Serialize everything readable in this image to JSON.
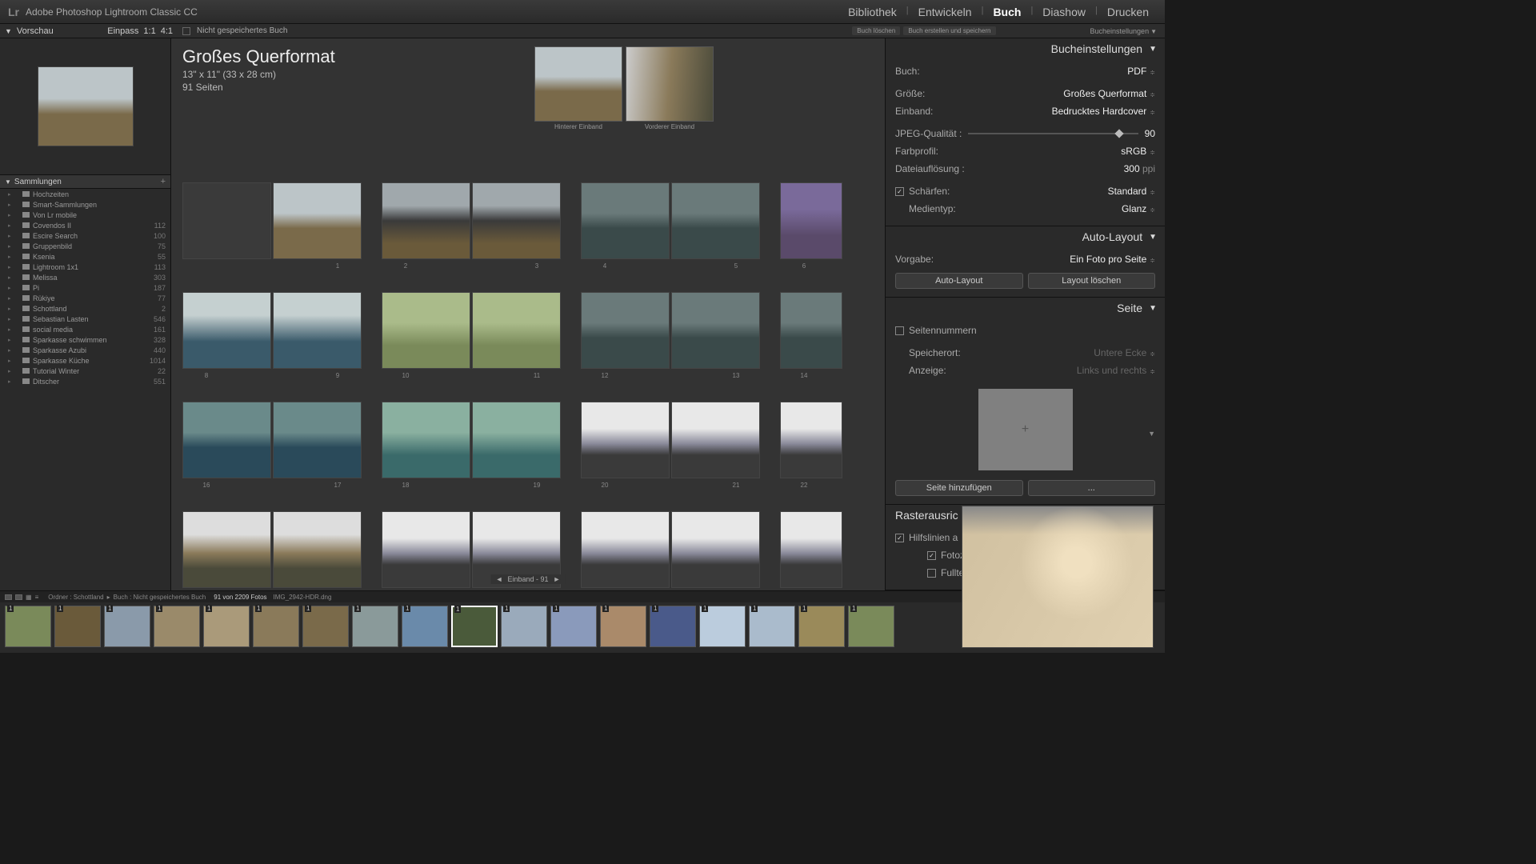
{
  "app": {
    "logo": "Lr",
    "title": "Adobe Photoshop Lightroom Classic CC"
  },
  "modules": [
    "Bibliothek",
    "Entwickeln",
    "Buch",
    "Diashow",
    "Drucken"
  ],
  "active_module": "Buch",
  "subbar": {
    "preview": "Vorschau",
    "einpass": "Einpass",
    "ratio1": "1:1",
    "ratio2": "4:1",
    "unsaved": "Nicht gespeichertes Buch",
    "btn_clear": "Buch löschen",
    "btn_save": "Buch erstellen und speichern",
    "settings": "Bucheinstellungen"
  },
  "collections": {
    "title": "Sammlungen",
    "items": [
      {
        "name": "Hochzeiten",
        "count": ""
      },
      {
        "name": "Smart-Sammlungen",
        "count": ""
      },
      {
        "name": "Von Lr mobile",
        "count": ""
      },
      {
        "name": "Covendos II",
        "count": "112"
      },
      {
        "name": "Escire Search",
        "count": "100"
      },
      {
        "name": "Gruppenbild",
        "count": "75"
      },
      {
        "name": "Ksenia",
        "count": "55"
      },
      {
        "name": "Lightroom 1x1",
        "count": "113"
      },
      {
        "name": "Melissa",
        "count": "303"
      },
      {
        "name": "Pi",
        "count": "187"
      },
      {
        "name": "Rükiye",
        "count": "77"
      },
      {
        "name": "Schottland",
        "count": "2"
      },
      {
        "name": "Sebastian Lasten",
        "count": "546"
      },
      {
        "name": "social media",
        "count": "161"
      },
      {
        "name": "Sparkasse schwimmen",
        "count": "328"
      },
      {
        "name": "Sparkasse Azubi",
        "count": "440"
      },
      {
        "name": "Sparkasse Küche",
        "count": "1014"
      },
      {
        "name": "Tutorial Winter",
        "count": "22"
      },
      {
        "name": "Ditscher",
        "count": "551"
      }
    ]
  },
  "book_header": {
    "title": "Großes Querformat",
    "dims": "13\" x 11\" (33 x 28 cm)",
    "pages": "91 Seiten",
    "back_cover": "Hinterer Einband",
    "front_cover": "Vorderer Einband"
  },
  "page_numbers": {
    "r1": [
      "",
      "1",
      "2",
      "3",
      "4",
      "5",
      "6",
      ""
    ],
    "r2": [
      "8",
      "9",
      "10",
      "11",
      "12",
      "13",
      "14",
      ""
    ],
    "r3": [
      "16",
      "17",
      "18",
      "19",
      "20",
      "21",
      "22",
      ""
    ],
    "r4": [
      "",
      "",
      "",
      "",
      "",
      "",
      "",
      ""
    ]
  },
  "settings": {
    "panel": "Bucheinstellungen",
    "book_l": "Buch:",
    "book_v": "PDF",
    "size_l": "Größe:",
    "size_v": "Großes Querformat",
    "cover_l": "Einband:",
    "cover_v": "Bedrucktes Hardcover",
    "jpeg_l": "JPEG-Qualität :",
    "jpeg_v": "90",
    "profile_l": "Farbprofil:",
    "profile_v": "sRGB",
    "res_l": "Dateiauflösung :",
    "res_v": "300",
    "res_u": "ppi",
    "sharp_l": "Schärfen:",
    "sharp_v": "Standard",
    "media_l": "Medientyp:",
    "media_v": "Glanz"
  },
  "auto_layout": {
    "panel": "Auto-Layout",
    "preset_l": "Vorgabe:",
    "preset_v": "Ein Foto pro Seite",
    "btn_auto": "Auto-Layout",
    "btn_clear": "Layout löschen"
  },
  "page_panel": {
    "panel": "Seite",
    "pagenums": "Seitennummern",
    "loc_l": "Speicherort:",
    "loc_v": "Untere Ecke",
    "disp_l": "Anzeige:",
    "disp_v": "Links und rechts",
    "btn_add": "Seite hinzufügen",
    "btn_add2": "..."
  },
  "guides": {
    "panel": "Rasterausric",
    "guides_l": "Hilfslinien a",
    "cells_l": "Fotozellen",
    "full_l": "Fulltext"
  },
  "footer": {
    "nav": "Einband - 91",
    "path1": "Ordner : Schottland",
    "sep": "▸",
    "path2": "Buch : Nicht gespeichertes Buch",
    "count": "91 von 2209 Fotos",
    "file": "IMG_2942-HDR.dng"
  }
}
